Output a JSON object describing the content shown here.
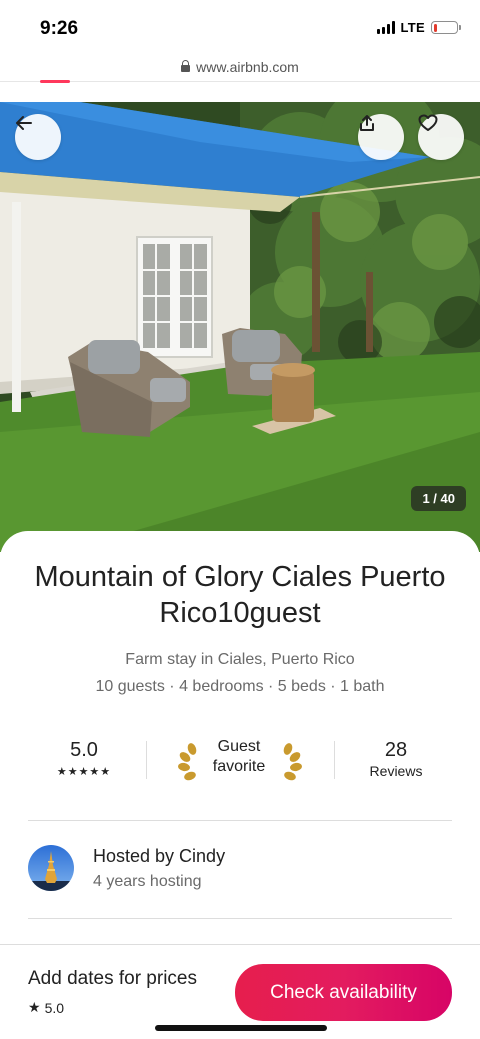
{
  "status_bar": {
    "time": "9:26",
    "network": "LTE",
    "battery_level": 0.15,
    "battery_color": "#e23b2e"
  },
  "browser": {
    "url": "www.airbnb.com"
  },
  "hero": {
    "photo_counter": "1 / 40",
    "back_icon": "arrow-left-icon",
    "share_icon": "share-icon",
    "save_icon": "heart-icon"
  },
  "listing": {
    "title": "Mountain of Glory Ciales Puerto Rico10guest",
    "subtitle": "Farm stay in Ciales, Puerto Rico",
    "details": "10 guests · 4 bedrooms · 5 beds · 1 bath"
  },
  "stats": {
    "rating": "5.0",
    "stars": "★★★★★",
    "guest_favorite_line1": "Guest",
    "guest_favorite_line2": "favorite",
    "reviews_count": "28",
    "reviews_label": "Reviews"
  },
  "host": {
    "name": "Hosted by Cindy",
    "years": "4 years hosting"
  },
  "footer": {
    "prices_label": "Add dates for prices",
    "rating": "5.0",
    "cta_label": "Check availability",
    "brand_color": "#e31c5f"
  }
}
